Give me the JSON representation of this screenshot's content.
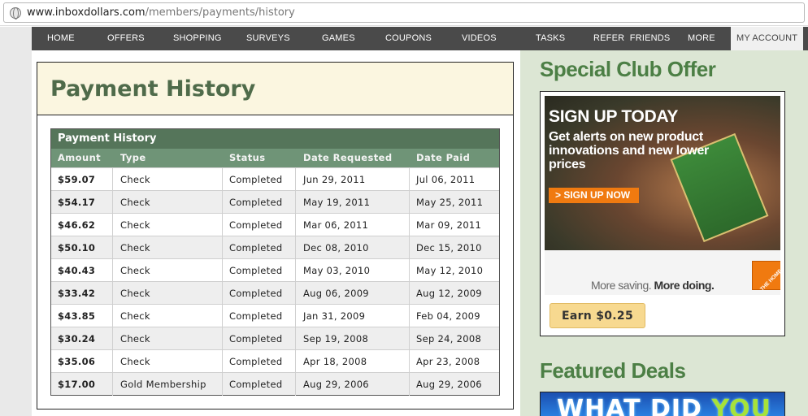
{
  "browser": {
    "url_host": "www.inboxdollars.com",
    "url_path": "/members/payments/history"
  },
  "nav": {
    "items": [
      {
        "label": "HOME",
        "key": "home"
      },
      {
        "label": "OFFERS",
        "key": "offers"
      },
      {
        "label": "SHOPPING",
        "key": "shopping"
      },
      {
        "label": "SURVEYS",
        "key": "surveys"
      },
      {
        "label": "GAMES",
        "key": "games"
      },
      {
        "label": "COUPONS",
        "key": "coupons"
      },
      {
        "label": "VIDEOS",
        "key": "videos"
      },
      {
        "label": "TASKS",
        "key": "tasks"
      },
      {
        "label": "REFER  FRIENDS",
        "key": "refer-friends"
      },
      {
        "label": "MORE",
        "key": "more"
      },
      {
        "label": "MY ACCOUNT",
        "key": "my-account",
        "active": true
      }
    ]
  },
  "main": {
    "page_title": "Payment History",
    "table": {
      "caption": "Payment History",
      "columns": [
        "Amount",
        "Type",
        "Status",
        "Date Requested",
        "Date Paid"
      ],
      "rows": [
        [
          "$59.07",
          "Check",
          "Completed",
          "Jun 29, 2011",
          "Jul 06, 2011"
        ],
        [
          "$54.17",
          "Check",
          "Completed",
          "May 19, 2011",
          "May 25, 2011"
        ],
        [
          "$46.62",
          "Check",
          "Completed",
          "Mar 06, 2011",
          "Mar 09, 2011"
        ],
        [
          "$50.10",
          "Check",
          "Completed",
          "Dec 08, 2010",
          "Dec 15, 2010"
        ],
        [
          "$40.43",
          "Check",
          "Completed",
          "May 03, 2010",
          "May 12, 2010"
        ],
        [
          "$33.42",
          "Check",
          "Completed",
          "Aug 06, 2009",
          "Aug 12, 2009"
        ],
        [
          "$43.85",
          "Check",
          "Completed",
          "Jan 31, 2009",
          "Feb 04, 2009"
        ],
        [
          "$30.24",
          "Check",
          "Completed",
          "Sep 19, 2008",
          "Sep 24, 2008"
        ],
        [
          "$35.06",
          "Check",
          "Completed",
          "Apr 18, 2008",
          "Apr 23, 2008"
        ],
        [
          "$17.00",
          "Gold Membership",
          "Completed",
          "Aug 29, 2006",
          "Aug 29, 2006"
        ]
      ]
    }
  },
  "sidebar": {
    "special_title": "Special Club Offer",
    "ad": {
      "headline": "SIGN UP TODAY",
      "subhead": "Get alerts on new product innovations and new lower prices",
      "cta": "> SIGN UP NOW",
      "tagline_light": "More saving. ",
      "tagline_bold": "More doing.",
      "logo_text": "THE HOME DEPOT"
    },
    "earn_label": "Earn $0.25",
    "featured_title": "Featured Deals",
    "featured_banner_a": "WHAT DID ",
    "featured_banner_b": "YOU"
  },
  "colors": {
    "nav_bg": "#4a4a4a",
    "title_green": "#4f6b4a",
    "table_header": "#6f9477",
    "sidebar_bg": "#dce6d4",
    "accent_orange": "#f07a10"
  }
}
